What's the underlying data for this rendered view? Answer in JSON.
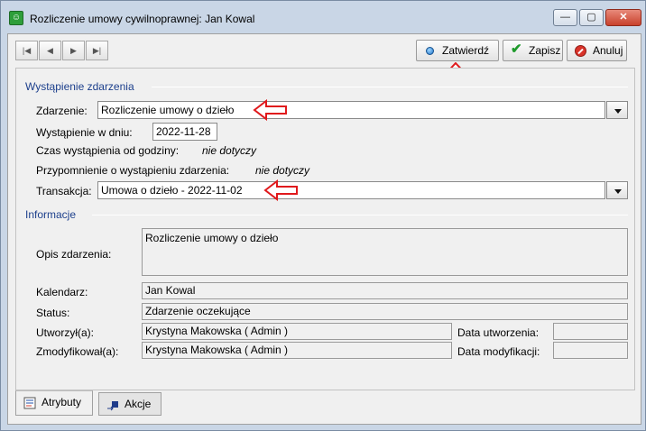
{
  "window": {
    "title": "Rozliczenie umowy cywilnoprawnej:  Jan Kowal",
    "min_glyph": "—",
    "max_glyph": "▢",
    "close_glyph": "✕"
  },
  "toolbar": {
    "nav": {
      "first": "|◀",
      "prev": "◀",
      "next": "▶",
      "last": "▶|"
    },
    "confirm_label": "Zatwierdź",
    "save_label": "Zapisz",
    "cancel_label": "Anuluj",
    "save_glyph": "✔"
  },
  "section_event": {
    "title": "Wystąpienie zdarzenia",
    "event_label": "Zdarzenie:",
    "event_value": "Rozliczenie umowy o dzieło",
    "date_label": "Wystąpienie w dniu:",
    "date_value": "2022-11-28",
    "time_label": "Czas wystąpienia od godziny:",
    "time_value": "nie dotyczy",
    "reminder_label": "Przypomnienie o wystąpieniu zdarzenia:",
    "reminder_value": "nie dotyczy",
    "transaction_label": "Transakcja:",
    "transaction_value": "Umowa o dzieło  -  2022-11-02"
  },
  "section_info": {
    "title": "Informacje",
    "description_label": "Opis zdarzenia:",
    "description_value": "Rozliczenie umowy o dzieło",
    "calendar_label": "Kalendarz:",
    "calendar_value": "Jan Kowal",
    "status_label": "Status:",
    "status_value": "Zdarzenie oczekujące",
    "created_by_label": "Utworzył(a):",
    "created_by_value": "Krystyna Makowska ( Admin )",
    "created_date_label": "Data utworzenia:",
    "created_date_value": "",
    "modified_by_label": "Zmodyfikował(a):",
    "modified_by_value": "Krystyna Makowska ( Admin )",
    "modified_date_label": "Data modyfikacji:",
    "modified_date_value": ""
  },
  "tabs": [
    {
      "label": "Atrybuty",
      "active": true
    },
    {
      "label": "Akcje",
      "active": false
    }
  ],
  "colors": {
    "section_title": "#1c3f8c",
    "annotation_arrow": "#e0191c",
    "window_frame": "#c9d6e6"
  }
}
